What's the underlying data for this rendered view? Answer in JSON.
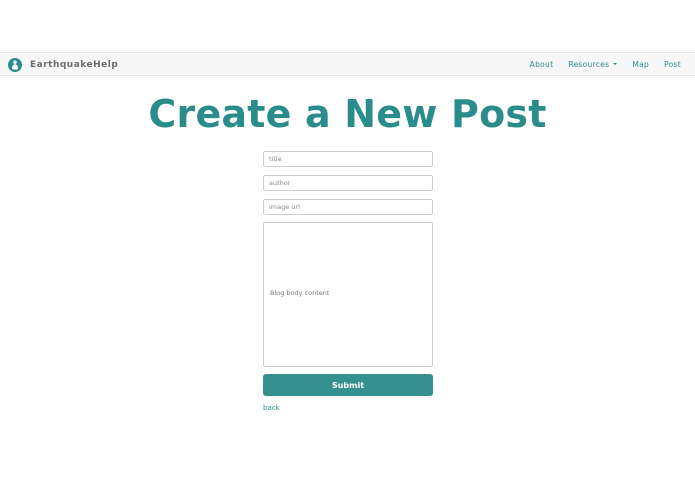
{
  "navbar": {
    "brand": "EarthquakeHelp",
    "links": [
      {
        "label": "About"
      },
      {
        "label": "Resources",
        "dropdown": true
      },
      {
        "label": "Map"
      },
      {
        "label": "Post"
      }
    ]
  },
  "page": {
    "title": "Create a New Post"
  },
  "form": {
    "title_placeholder": "title",
    "author_placeholder": "author",
    "image_placeholder": "image url",
    "body_placeholder": "Blog body content",
    "submit_label": "Submit",
    "back_label": "back"
  },
  "colors": {
    "accent": "#2b8c8c",
    "button": "#35918f",
    "navbar_bg": "#f7f7f7"
  },
  "icons": {
    "brand": "house-person-icon",
    "resources_dropdown": "caret-down-icon"
  }
}
